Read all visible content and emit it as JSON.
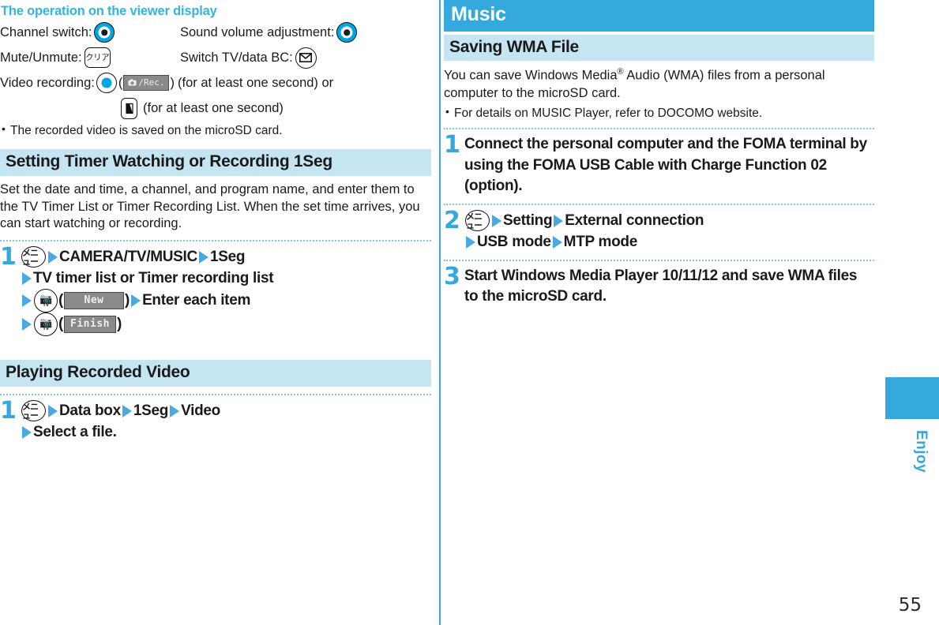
{
  "page": {
    "number": "55",
    "side_tab_label": "Enjoy",
    "accent_blue": "#35a8dd",
    "heading_band": "#c5e5f2"
  },
  "left_column": {
    "viewer_title": "The operation on the viewer display",
    "operations": [
      {
        "label": "Channel switch:",
        "icon": "nav-key-icon"
      },
      {
        "label": "Sound volume adjustment:",
        "icon": "nav-key-icon"
      },
      {
        "label": "Mute/Unmute:",
        "icon": "clear-key-icon",
        "key_text": "クリア"
      },
      {
        "label": "Switch TV/data BC:",
        "icon": "mail-key-icon"
      }
    ],
    "video_recording": {
      "label": "Video recording:",
      "center_key_icon": "center-select-key-icon",
      "open_paren": "(",
      "rec_badge": "/Rec.",
      "close_paren": ")",
      "suffix_1": "(for at least one second) or",
      "page_key_icon": "page-key-icon",
      "suffix_2": "(for at least one second)"
    },
    "note": "The recorded video is saved on the microSD card.",
    "section1": {
      "heading": "Setting Timer Watching or Recording 1Seg",
      "body": "Set the date and time, a channel, and program name, and enter them to the TV Timer List or Timer Recording List. When the set time arrives, you can start watching or recording.",
      "step1": {
        "number": "1",
        "menu_key": "メニュー",
        "line1_a": "CAMERA/TV/MUSIC",
        "line1_b": "1Seg",
        "line2": "TV timer list or Timer recording list",
        "line3_badge": "New",
        "line3_after": "Enter each item",
        "line4_badge": "Finish"
      }
    },
    "section2": {
      "heading": "Playing Recorded Video",
      "step1": {
        "number": "1",
        "menu_key": "メニュー",
        "a": "Data box",
        "b": "1Seg",
        "c": "Video",
        "d": "Select a file."
      }
    }
  },
  "right_column": {
    "chapter": "Music",
    "section_heading": "Saving WMA File",
    "intro_before": "You can save Windows Media",
    "intro_sup": "®",
    "intro_after": " Audio (WMA) files from a personal computer to the microSD card.",
    "note": "For details on MUSIC Player, refer to DOCOMO website.",
    "steps": [
      {
        "number": "1",
        "text": "Connect the personal computer and the FOMA terminal by using the FOMA USB Cable with Charge Function 02 (option)."
      },
      {
        "number": "2",
        "menu_key": "メニュー",
        "a": "Setting",
        "b": "External connection",
        "c": "USB mode",
        "d": "MTP mode"
      },
      {
        "number": "3",
        "text": "Start Windows Media Player 10/11/12 and save WMA files to the microSD card."
      }
    ]
  }
}
